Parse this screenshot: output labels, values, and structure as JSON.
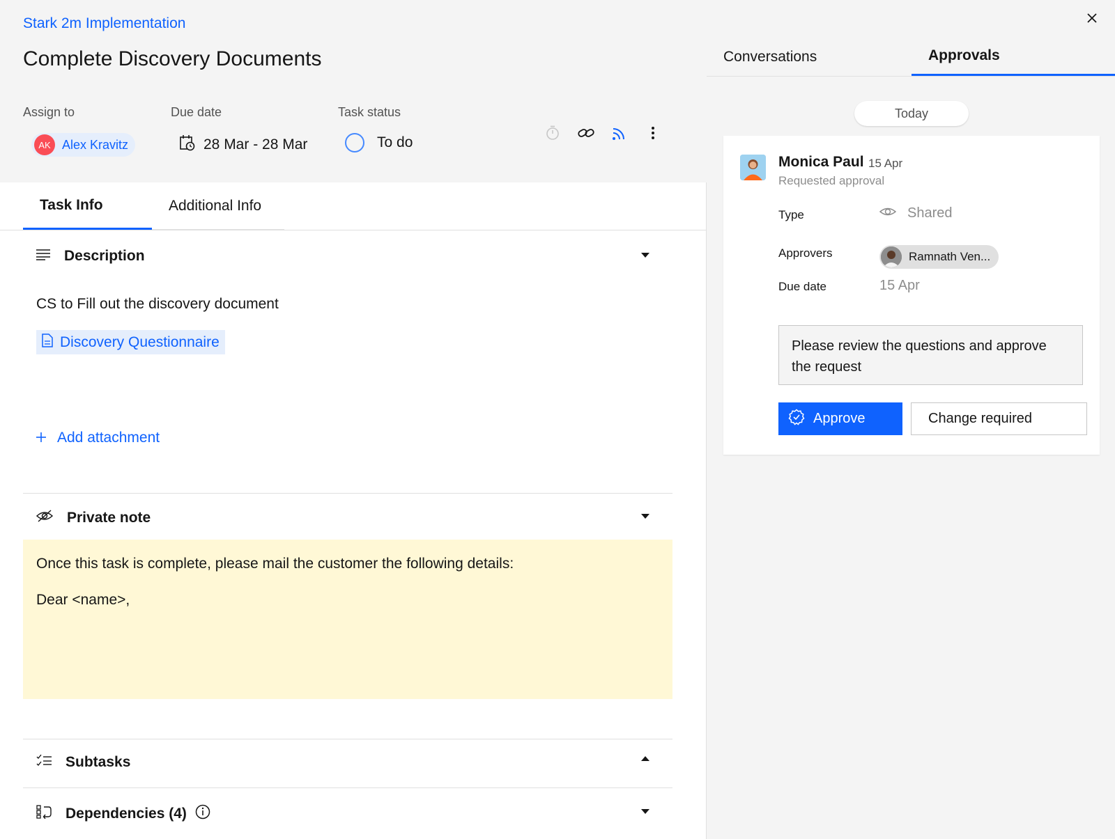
{
  "task": {
    "breadcrumb": "Stark 2m Implementation",
    "title": "Complete Discovery Documents",
    "assign_label": "Assign to",
    "assignee_initials": "AK",
    "assignee_name": "Alex Kravitz",
    "due_label": "Due date",
    "due_value": "28 Mar - 28 Mar",
    "status_label": "Task status",
    "status_value": "To do"
  },
  "toolbar": {
    "icons": [
      "timer-icon",
      "link-icon",
      "feed-icon",
      "overflow-menu-icon"
    ]
  },
  "tabs": [
    {
      "label": "Task Info",
      "active": true
    },
    {
      "label": "Additional Info",
      "active": false
    }
  ],
  "description": {
    "heading": "Description",
    "text": "CS to Fill out the discovery document",
    "attachment": "Discovery Questionnaire",
    "add_attachment": "Add attachment"
  },
  "private_note": {
    "heading": "Private note",
    "line1": "Once this task is complete, please mail the customer the following details:",
    "line2": "Dear <name>,"
  },
  "subtasks": {
    "heading": "Subtasks"
  },
  "dependencies": {
    "heading": "Dependencies",
    "count": "(4)"
  },
  "panel": {
    "tabs": [
      {
        "label": "Conversations",
        "active": false
      },
      {
        "label": "Approvals",
        "active": true
      }
    ],
    "today": "Today",
    "card": {
      "requester": "Monica Paul",
      "date": "15 Apr",
      "action": "Requested approval",
      "type_label": "Type",
      "type_value": "Shared",
      "approvers_label": "Approvers",
      "approver_name": "Ramnath Ven...",
      "due_label": "Due date",
      "due_value": "15 Apr",
      "comment": "Please review the questions and approve the request",
      "approve_label": "Approve",
      "change_label": "Change required"
    }
  },
  "colors": {
    "accent": "#0f62fe",
    "note_bg": "#fff8d6",
    "avatar_red": "#fa4d56"
  }
}
